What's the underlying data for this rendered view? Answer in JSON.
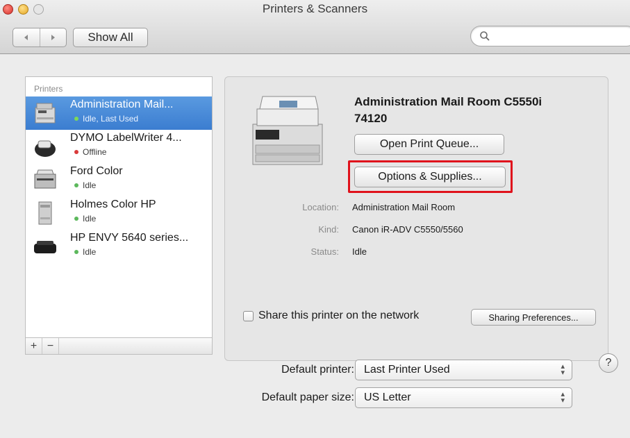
{
  "window": {
    "title": "Printers & Scanners"
  },
  "toolbar": {
    "back_icon": "chevron-left-icon",
    "forward_icon": "chevron-right-icon",
    "show_all_label": "Show All",
    "search_placeholder": ""
  },
  "sidebar": {
    "header": "Printers",
    "printers": [
      {
        "name": "Administration Mail...",
        "status": "Idle, Last Used",
        "status_color": "#7ed957",
        "selected": true,
        "icon": "multifunction-printer-icon"
      },
      {
        "name": "DYMO LabelWriter 4...",
        "status": "Offline",
        "status_color": "#d93a3a",
        "selected": false,
        "icon": "label-printer-icon"
      },
      {
        "name": "Ford Color",
        "status": "Idle",
        "status_color": "#5cb85c",
        "selected": false,
        "icon": "laser-printer-icon"
      },
      {
        "name": "Holmes Color HP",
        "status": "Idle",
        "status_color": "#5cb85c",
        "selected": false,
        "icon": "tower-printer-icon"
      },
      {
        "name": "HP ENVY 5640 series...",
        "status": "Idle",
        "status_color": "#5cb85c",
        "selected": false,
        "icon": "inkjet-printer-icon"
      }
    ],
    "add_label": "+",
    "remove_label": "−"
  },
  "details": {
    "title_line1": "Administration Mail Room C5550i",
    "title_line2": "74120",
    "open_queue_label": "Open Print Queue...",
    "options_label": "Options & Supplies...",
    "location_label": "Location:",
    "location_value": "Administration Mail Room",
    "kind_label": "Kind:",
    "kind_value": "Canon iR-ADV C5550/5560",
    "status_label": "Status:",
    "status_value": "Idle",
    "share_label": "Share this printer on the network",
    "share_checked": false,
    "sharing_prefs_label": "Sharing Preferences..."
  },
  "defaults": {
    "printer_label": "Default printer:",
    "printer_value": "Last Printer Used",
    "paper_label": "Default paper size:",
    "paper_value": "US Letter"
  },
  "help_label": "?",
  "colors": {
    "selection": "#3b7dd0",
    "highlight": "#e0121c"
  }
}
